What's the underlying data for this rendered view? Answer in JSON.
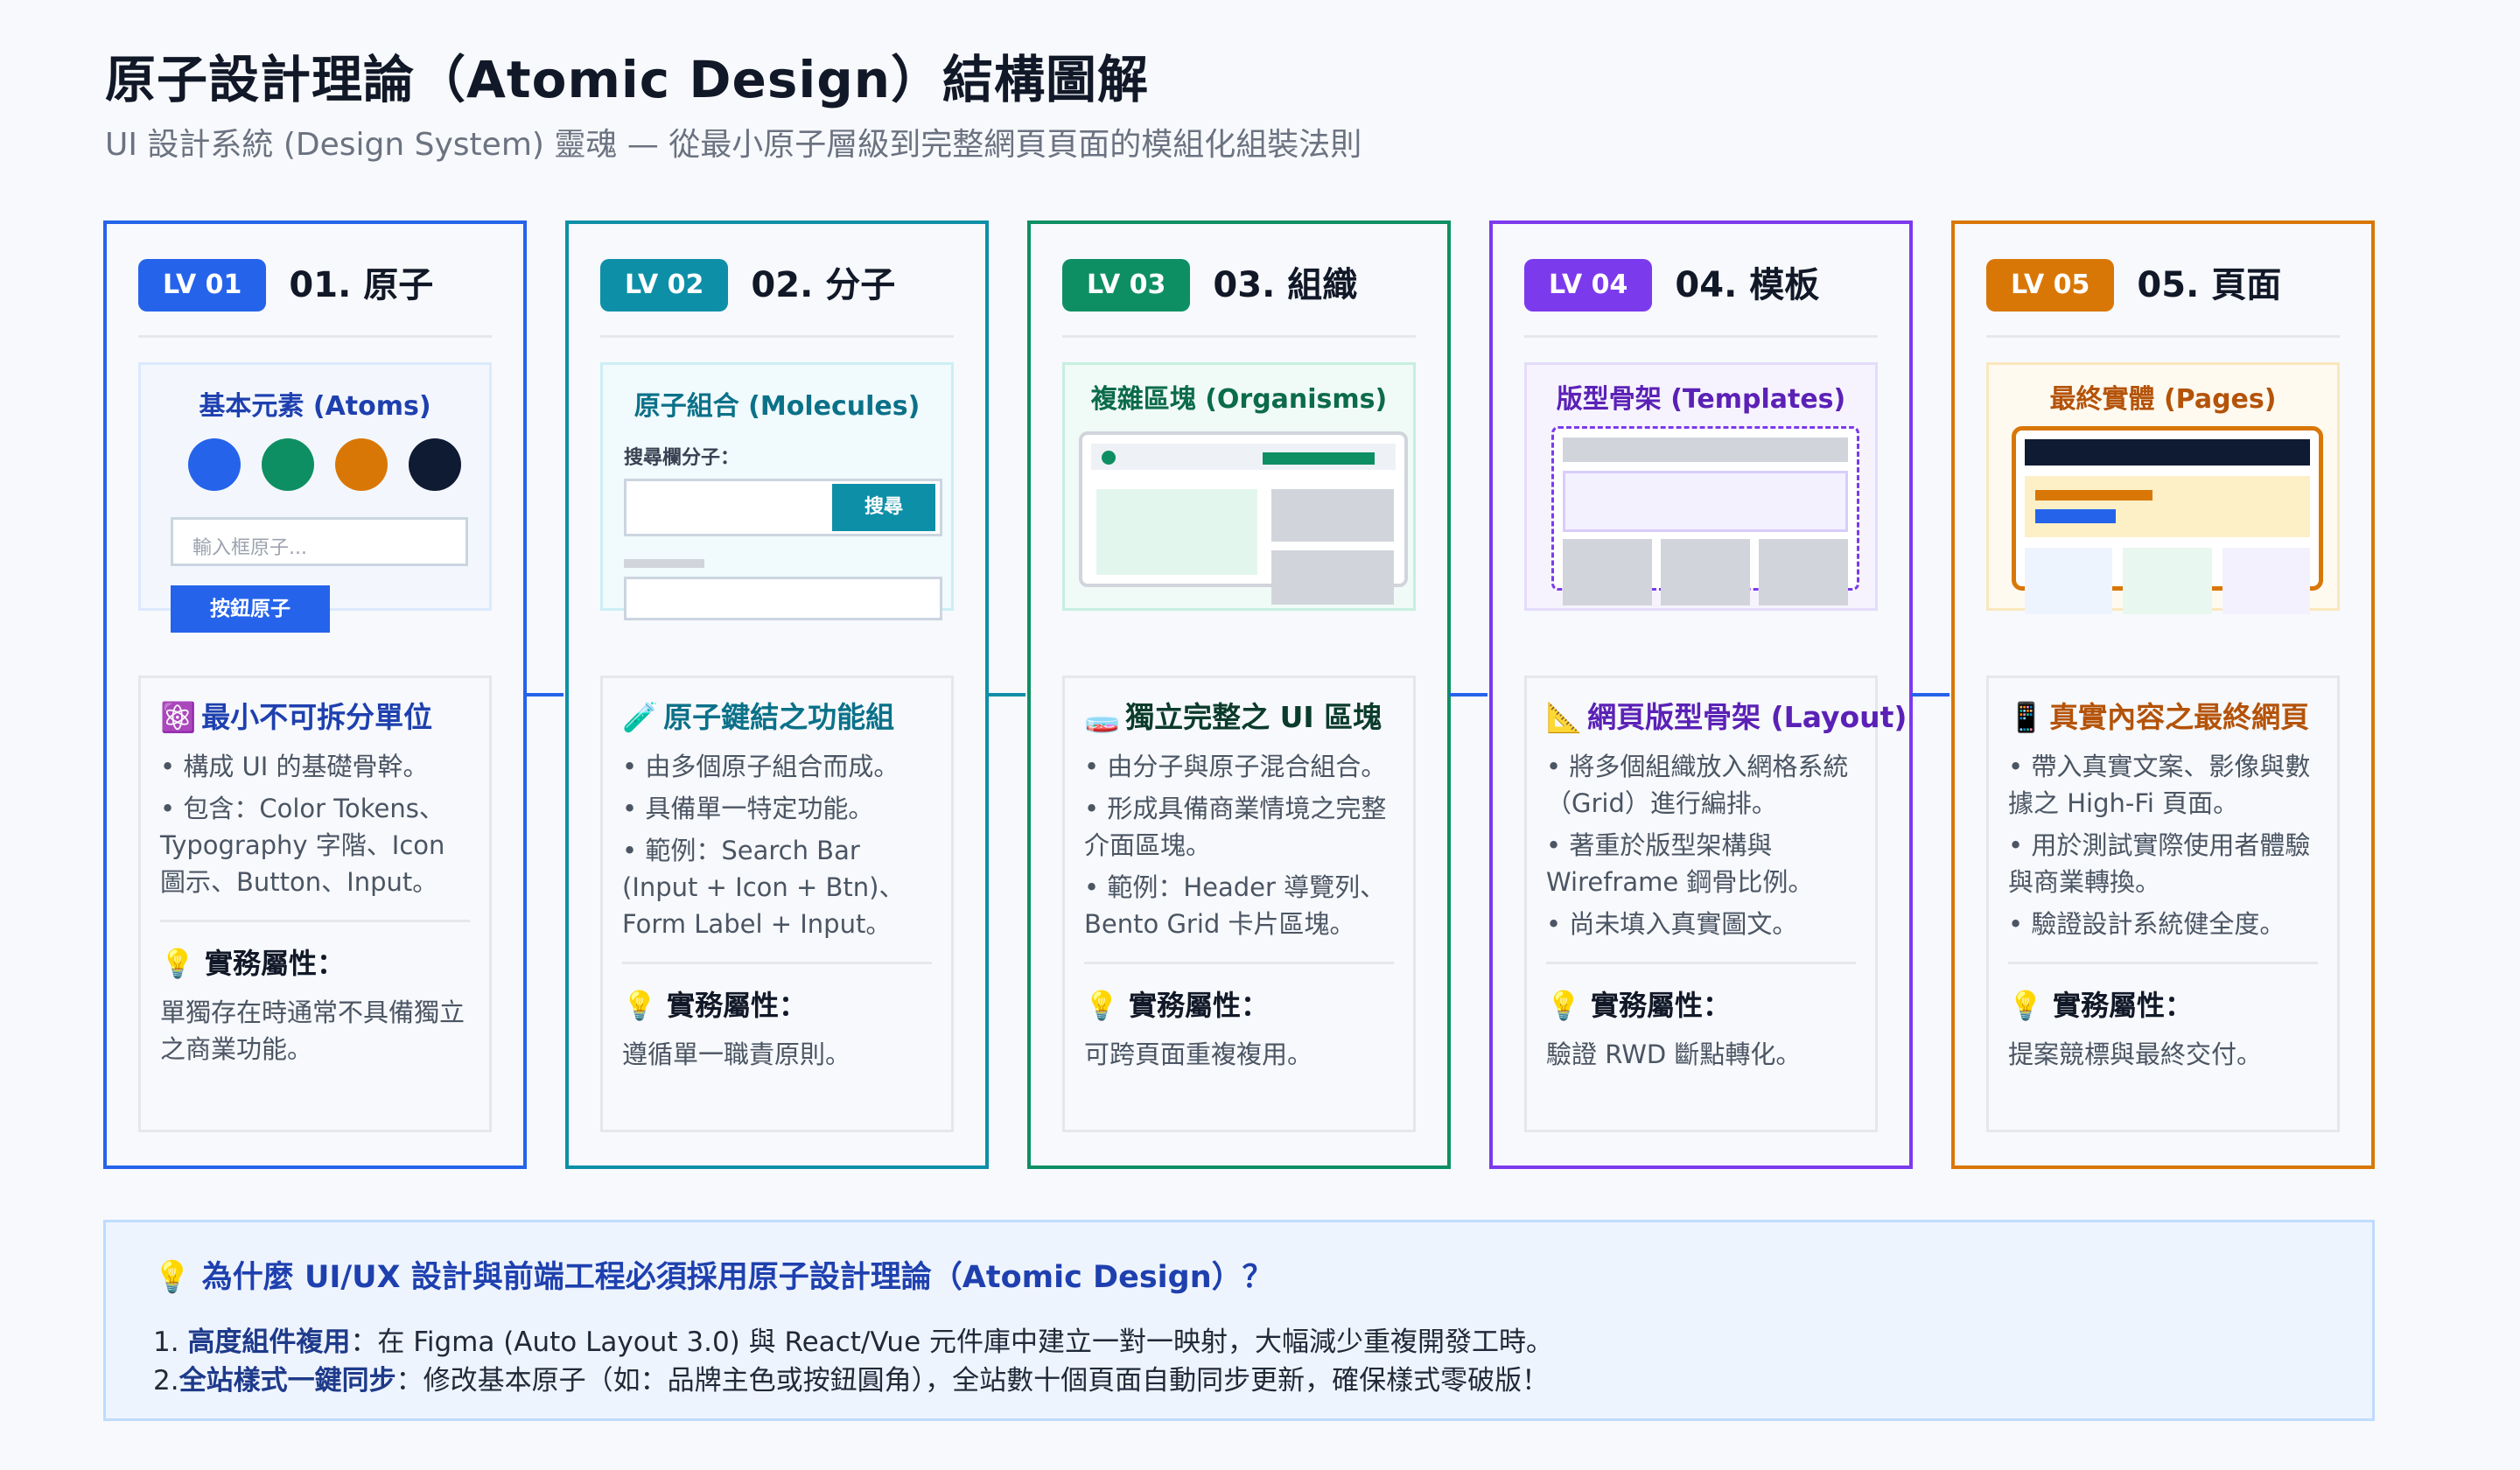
{
  "title": "原子設計理論（Atomic Design）結構圖解",
  "subtitle": "UI 設計系統 (Design System) 靈魂 — 從最小原子層級到完整網頁頁面的模組化組裝法則",
  "colors": {
    "blue": "#2563eb",
    "teal": "#0e8fa8",
    "green": "#0e8f63",
    "purple": "#7c3aed",
    "orange": "#d97706",
    "navy": "#0f1a33"
  },
  "levels": [
    {
      "badge": "LV 01",
      "title": "01. 原子",
      "color": "#2563eb",
      "preview_title": "基本元素 (Atoms)",
      "input_placeholder": "輸入框原子...",
      "button_label": "按鈕原子",
      "info_icon": "⚛️",
      "info_title": "最小不可拆分單位",
      "bullets": [
        "• 構成 UI 的基礎骨幹。",
        "• 包含：Color Tokens、Typography 字階、Icon 圖示、Button、Input。"
      ],
      "prop_label": "💡 實務屬性：",
      "prop_text": "單獨存在時通常不具備獨立之商業功能。"
    },
    {
      "badge": "LV 02",
      "title": "02. 分子",
      "color": "#0e8fa8",
      "preview_title": "原子組合 (Molecules)",
      "field_label": "搜尋欄分子：",
      "search_button": "搜尋",
      "info_icon": "🧪",
      "info_title": "原子鍵結之功能組",
      "bullets": [
        "• 由多個原子組合而成。",
        "• 具備單一特定功能。",
        "• 範例：Search Bar (Input + Icon + Btn)、Form Label + Input。"
      ],
      "prop_label": "💡 實務屬性：",
      "prop_text": "遵循單一職責原則。"
    },
    {
      "badge": "LV 03",
      "title": "03. 組織",
      "color": "#0e8f63",
      "preview_title": "複雜區塊 (Organisms)",
      "info_icon": "🧫",
      "info_title": "獨立完整之 UI 區塊",
      "bullets": [
        "• 由分子與原子混合組合。",
        "• 形成具備商業情境之完整介面區塊。",
        "• 範例：Header 導覽列、Bento Grid 卡片區塊。"
      ],
      "prop_label": "💡 實務屬性：",
      "prop_text": "可跨頁面重複複用。"
    },
    {
      "badge": "LV 04",
      "title": "04. 模板",
      "color": "#7c3aed",
      "preview_title": "版型骨架 (Templates)",
      "info_icon": "📐",
      "info_title": "網頁版型骨架 (Layout)",
      "bullets": [
        "• 將多個組織放入網格系統（Grid）進行編排。",
        "• 著重於版型架構與 Wireframe 鋼骨比例。",
        "• 尚未填入真實圖文。"
      ],
      "prop_label": "💡 實務屬性：",
      "prop_text": "驗證 RWD 斷點轉化。"
    },
    {
      "badge": "LV 05",
      "title": "05. 頁面",
      "color": "#d97706",
      "preview_title": "最終實體 (Pages)",
      "info_icon": "📱",
      "info_title": "真實內容之最終網頁",
      "bullets": [
        "• 帶入真實文案、影像與數據之 High-Fi 頁面。",
        "• 用於測試實際使用者體驗與商業轉換。",
        "• 驗證設計系統健全度。"
      ],
      "prop_label": "💡 實務屬性：",
      "prop_text": "提案競標與最終交付。"
    }
  ],
  "footer": {
    "title": "💡 為什麼 UI/UX 設計與前端工程必須採用原子設計理論（Atomic Design）？",
    "line1_prefix": "1. ",
    "line1_bold": "高度組件複用",
    "line1_text": "：在 Figma (Auto Layout 3.0) 與 React/Vue 元件庫中建立一對一映射，大幅減少重複開發工時。",
    "line2_prefix": "2.",
    "line2_bold": "全站樣式一鍵同步",
    "line2_text": "：修改基本原子（如：品牌主色或按鈕圓角），全站數十個頁面自動同步更新，確保樣式零破版！"
  }
}
